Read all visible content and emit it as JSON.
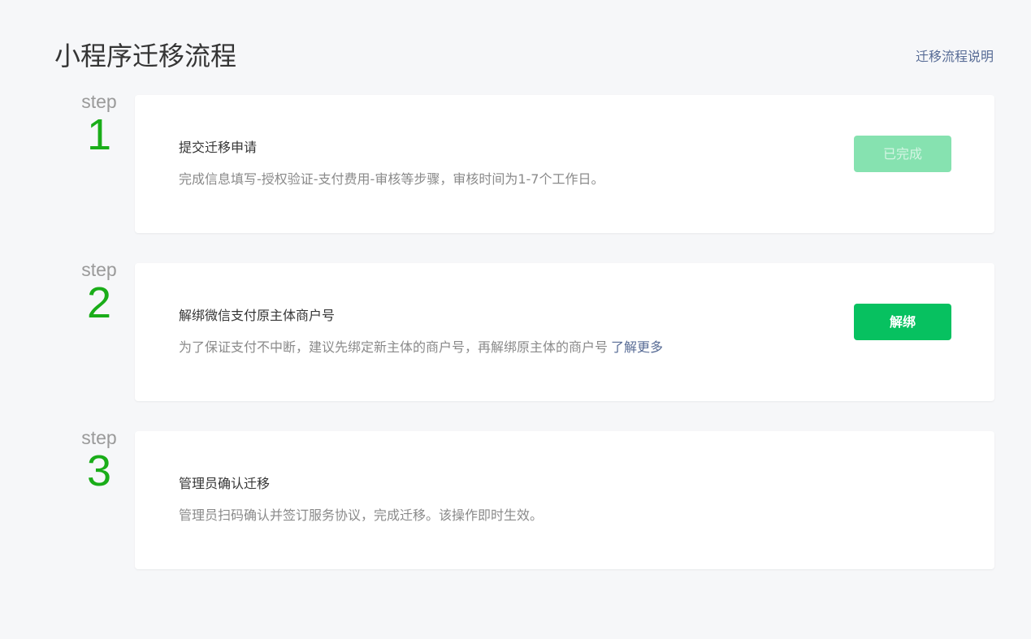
{
  "header": {
    "title": "小程序迁移流程",
    "help_link": "迁移流程说明"
  },
  "steps": [
    {
      "label": "step",
      "number": "1",
      "title": "提交迁移申请",
      "desc": "完成信息填写-授权验证-支付费用-审核等步骤，审核时间为1-7个工作日。",
      "button": "已完成",
      "button_state": "disabled"
    },
    {
      "label": "step",
      "number": "2",
      "title": "解绑微信支付原主体商户号",
      "desc": "为了保证支付不中断，建议先绑定新主体的商户号，再解绑原主体的商户号",
      "link": "了解更多",
      "button": "解绑",
      "button_state": "enabled"
    },
    {
      "label": "step",
      "number": "3",
      "title": "管理员确认迁移",
      "desc": "管理员扫码确认并签订服务协议，完成迁移。该操作即时生效。"
    }
  ],
  "colors": {
    "accent_green": "#07c160",
    "step_number_green": "#1aad19",
    "link_blue": "#576b95",
    "disabled_button": "#86e2b0"
  }
}
